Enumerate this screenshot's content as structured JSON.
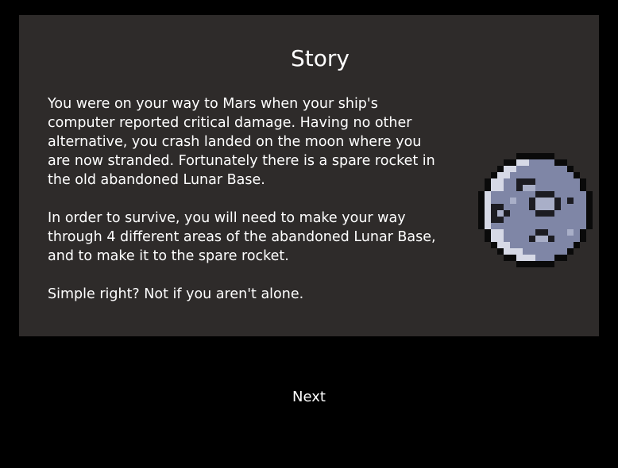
{
  "story": {
    "title": "Story",
    "paragraphs": [
      "You were on your way to Mars when your ship's\ncomputer reported critical damage. Having no other\nalternative, you crash landed on the moon where you\nare now stranded. Fortunately there is a spare rocket in\nthe old abandoned Lunar Base.",
      "In order to survive, you will need to make your way\nthrough 4 different areas of the abandoned Lunar Base,\nand to make it to the spare rocket.",
      "Simple right? Not if you aren't alone."
    ],
    "image_icon": "pixel-moon-icon"
  },
  "controls": {
    "next_label": "Next"
  },
  "colors": {
    "background": "#000000",
    "panel": "#2e2b2a",
    "text": "#ffffff",
    "moon_base": "#7f86a6",
    "moon_light": "#d6d9e6",
    "moon_crater": "#1c1c22",
    "moon_outline": "#0a0a0a"
  }
}
